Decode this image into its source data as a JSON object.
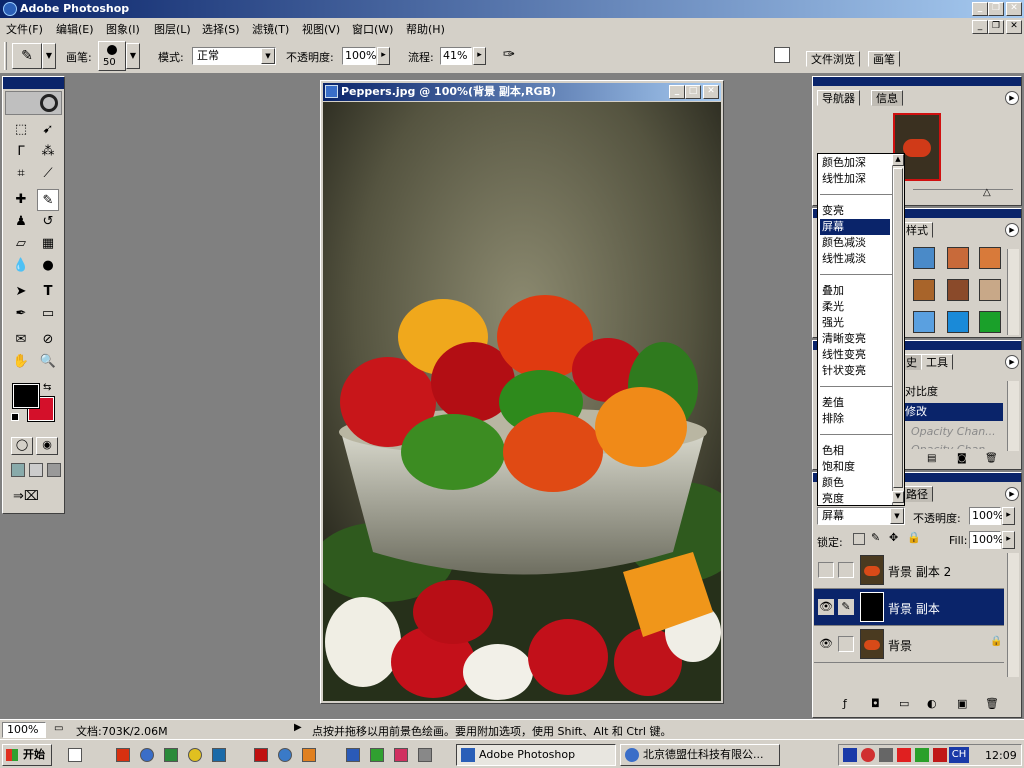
{
  "window": {
    "title": "Adobe Photoshop"
  },
  "menu": [
    "文件(F)",
    "编辑(E)",
    "图象(I)",
    "图层(L)",
    "选择(S)",
    "滤镜(T)",
    "视图(V)",
    "窗口(W)",
    "帮助(H)"
  ],
  "options": {
    "brush_label": "画笔:",
    "brush_size": "50",
    "mode_label": "模式:",
    "mode_value": "正常",
    "opacity_label": "不透明度:",
    "opacity_value": "100%",
    "flow_label": "流程:",
    "flow_value": "41%",
    "tab_file_browser": "文件浏览",
    "tab_brushes": "画笔"
  },
  "document": {
    "title": "Peppers.jpg @ 100%(背景 副本,RGB)"
  },
  "navigator": {
    "tab_navigator": "导航器",
    "tab_info": "信息"
  },
  "styles": {
    "tab_partial": "样式"
  },
  "history": {
    "tab_partial": "史",
    "tab_tools": "工具",
    "items": [
      "对比度",
      "修改",
      "Opacity Chan...",
      "Opacity Chan..."
    ]
  },
  "blend_menu": {
    "groups": [
      [
        "颜色加深",
        "线性加深"
      ],
      [
        "变亮",
        "屏幕",
        "颜色减淡",
        "线性减淡"
      ],
      [
        "叠加",
        "柔光",
        "强光",
        "清晰变亮",
        "线性变亮",
        "针状变亮"
      ],
      [
        "差值",
        "排除"
      ],
      [
        "色相",
        "饱和度",
        "颜色",
        "亮度"
      ]
    ],
    "selected": "屏幕"
  },
  "layers": {
    "tab_partial": "路径",
    "blend_value": "屏幕",
    "opacity_label": "不透明度:",
    "opacity_value": "100%",
    "lock_label": "锁定:",
    "fill_label": "Fill:",
    "fill_value": "100%",
    "rows": [
      {
        "name": "背景 副本 2"
      },
      {
        "name": "背景 副本"
      },
      {
        "name": "背景"
      }
    ]
  },
  "status": {
    "zoom": "100%",
    "doc_info": "文档:703K/2.06M",
    "hint": "点按并拖移以用前景色绘画。要用附加选项，使用 Shift、Alt 和 Ctrl 键。"
  },
  "taskbar": {
    "start": "开始",
    "tasks": [
      "Adobe Photoshop",
      "北京德盟仕科技有限公..."
    ],
    "tray_ime": "CH",
    "clock": "12:09"
  },
  "colors": {
    "foreground": "#000000",
    "background": "#d4102a",
    "titlebar": "#0a246a",
    "selection": "#0a246a"
  }
}
